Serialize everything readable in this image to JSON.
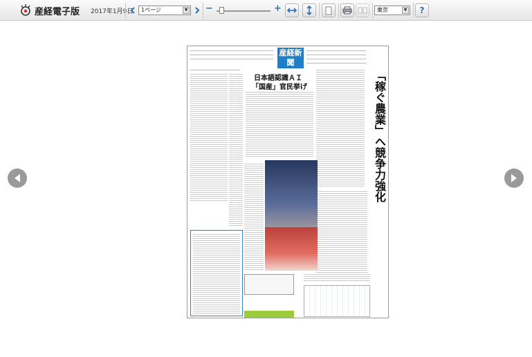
{
  "app": {
    "title": "産経電子版",
    "date": "2017年1月9日"
  },
  "toolbar": {
    "page_select_value": "1ページ",
    "zoom_minus": "−",
    "zoom_plus": "+",
    "zoom_level": 0.05,
    "region_select_value": "東京",
    "help_label": "?"
  },
  "newspaper": {
    "masthead": "産経新聞",
    "headline_main": "「稼ぐ農業」へ競争力強化",
    "headline_ai_1": "日本語認識ＡＩ",
    "headline_ai_2": "「国産」官民挙げ"
  },
  "icons": {
    "logo": "sankei-logo-icon",
    "prev_day": "chevron-left-icon",
    "next_day": "chevron-right-icon",
    "fit_width": "fit-width-icon",
    "fit_height": "fit-height-icon",
    "single_page": "single-page-icon",
    "print": "print-icon",
    "spread": "double-page-icon",
    "prev_page": "arrow-left-icon",
    "next_page": "arrow-right-icon"
  }
}
